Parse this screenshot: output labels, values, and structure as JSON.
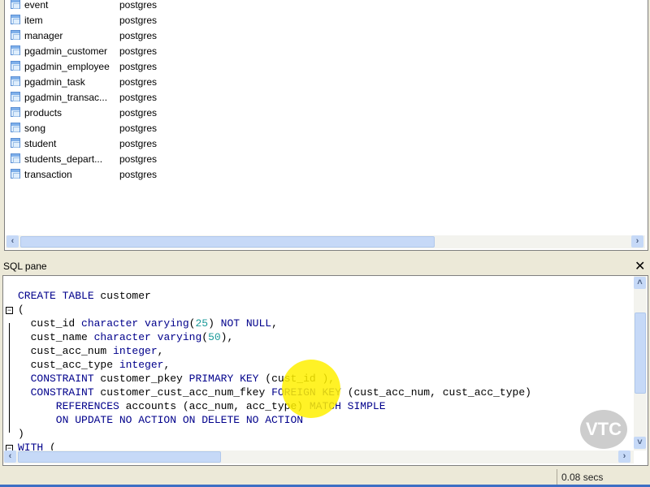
{
  "tables": [
    {
      "name": "event",
      "owner": "postgres"
    },
    {
      "name": "item",
      "owner": "postgres"
    },
    {
      "name": "manager",
      "owner": "postgres"
    },
    {
      "name": "pgadmin_customer",
      "owner": "postgres"
    },
    {
      "name": "pgadmin_employee",
      "owner": "postgres"
    },
    {
      "name": "pgadmin_task",
      "owner": "postgres"
    },
    {
      "name": "pgadmin_transac...",
      "owner": "postgres"
    },
    {
      "name": "products",
      "owner": "postgres"
    },
    {
      "name": "song",
      "owner": "postgres"
    },
    {
      "name": "student",
      "owner": "postgres"
    },
    {
      "name": "students_depart...",
      "owner": "postgres"
    },
    {
      "name": "transaction",
      "owner": "postgres"
    }
  ],
  "sql_pane": {
    "title": "SQL pane",
    "close": "✕",
    "lines": [
      [
        [
          "CREATE TABLE",
          "kw"
        ],
        [
          " customer",
          ""
        ]
      ],
      [
        [
          "(",
          ""
        ]
      ],
      [
        [
          "  cust_id ",
          ""
        ],
        [
          "character varying",
          "kw"
        ],
        [
          "(",
          ""
        ],
        [
          "25",
          "num"
        ],
        [
          ") ",
          ""
        ],
        [
          "NOT NULL",
          "kw"
        ],
        [
          ",",
          ""
        ]
      ],
      [
        [
          "  cust_name ",
          ""
        ],
        [
          "character varying",
          "kw"
        ],
        [
          "(",
          ""
        ],
        [
          "50",
          "num"
        ],
        [
          "),",
          ""
        ]
      ],
      [
        [
          "  cust_acc_num ",
          ""
        ],
        [
          "integer",
          "kw"
        ],
        [
          ",",
          ""
        ]
      ],
      [
        [
          "  cust_acc_type ",
          ""
        ],
        [
          "integer",
          "kw"
        ],
        [
          ",",
          ""
        ]
      ],
      [
        [
          "  CONSTRAINT",
          "kw"
        ],
        [
          " customer_pkey ",
          ""
        ],
        [
          "PRIMARY KEY",
          "kw"
        ],
        [
          " (cust_id ),",
          ""
        ]
      ],
      [
        [
          "  CONSTRAINT",
          "kw"
        ],
        [
          " customer_cust_acc_num_fkey ",
          ""
        ],
        [
          "FOREIGN KEY",
          "kw"
        ],
        [
          " (cust_acc_num, cust_acc_type)",
          ""
        ]
      ],
      [
        [
          "      REFERENCES",
          "kw"
        ],
        [
          " accounts (acc_num, acc_type) ",
          ""
        ],
        [
          "MATCH SIMPLE",
          "kw"
        ]
      ],
      [
        [
          "      ON UPDATE NO ACTION ON DELETE NO ACTION",
          "kw"
        ]
      ],
      [
        [
          ")",
          ""
        ]
      ],
      [
        [
          "WITH",
          "kw"
        ],
        [
          " (",
          ""
        ]
      ]
    ]
  },
  "watermark": "VTC",
  "status": {
    "time": "0.08 secs"
  },
  "colors": {
    "keyword": "#00008b",
    "number": "#1a9a9a",
    "scroll_thumb": "#c6d9f7"
  }
}
